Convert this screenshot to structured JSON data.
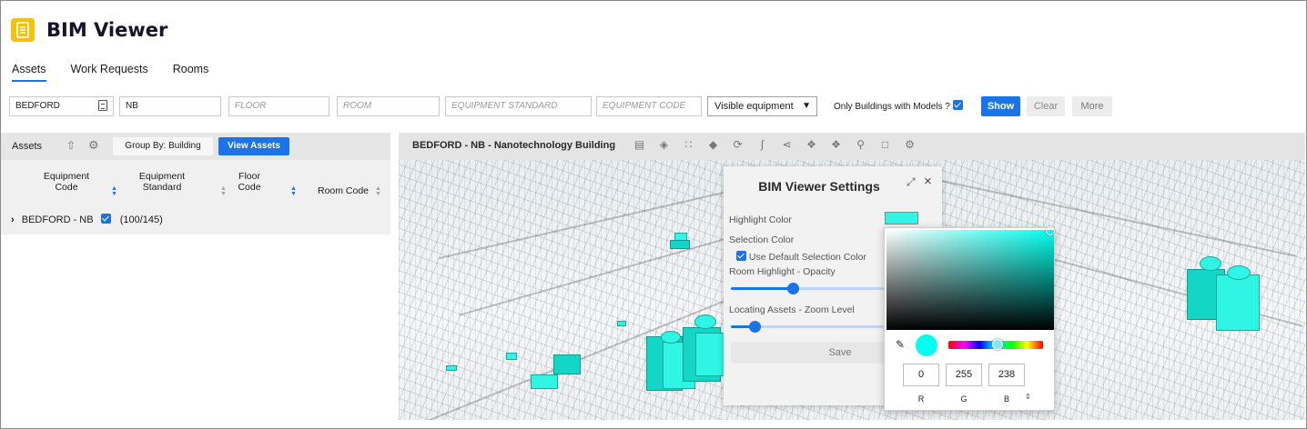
{
  "app": {
    "title": "BIM Viewer",
    "logo_icon": "building-document-icon",
    "logo_color": "#f4c20d"
  },
  "tabs": [
    {
      "label": "Assets",
      "active": true
    },
    {
      "label": "Work Requests",
      "active": false
    },
    {
      "label": "Rooms",
      "active": false
    }
  ],
  "filters": {
    "site": "BEDFORD",
    "building": "NB",
    "floor_placeholder": "FLOOR",
    "room_placeholder": "ROOM",
    "equipment_standard_placeholder": "EQUIPMENT STANDARD",
    "equipment_code_placeholder": "EQUIPMENT CODE",
    "visibility_select": "Visible equipment",
    "only_models_label": "Only Buildings with Models ?",
    "only_models_checked": true,
    "show_label": "Show",
    "clear_label": "Clear",
    "more_label": "More"
  },
  "assets_panel": {
    "title": "Assets",
    "group_by_label": "Group By: Building",
    "view_assets_label": "View Assets",
    "columns": [
      {
        "line1": "Equipment",
        "line2": "Code"
      },
      {
        "line1": "Equipment",
        "line2": "Standard"
      },
      {
        "line1": "Floor",
        "line2": "Code"
      },
      {
        "line1": "Room Code",
        "line2": ""
      }
    ],
    "group_row": {
      "label": "BEDFORD - NB",
      "checked": true,
      "count": "(100/145)"
    }
  },
  "viewer": {
    "title": "BEDFORD - NB - Nanotechnology Building",
    "toolbar_icons": [
      "floors-icon",
      "layers-icon",
      "grid-icon",
      "tag-icon",
      "rotate-icon",
      "section-icon",
      "share-icon",
      "ghost-icon",
      "orbit-icon",
      "search-icon",
      "document-icon",
      "settings-icon"
    ]
  },
  "settings": {
    "title": "BIM Viewer Settings",
    "highlight_color_label": "Highlight Color",
    "highlight_color": "#2ef5e4",
    "selection_color_label": "Selection Color",
    "use_default_selection_label": "Use Default Selection Color",
    "use_default_selection_checked": true,
    "room_opacity_label": "Room Highlight - Opacity",
    "zoom_level_label": "Locating Assets - Zoom Level",
    "save_label": "Save"
  },
  "color_picker": {
    "r": "0",
    "g": "255",
    "b": "238",
    "r_label": "R",
    "g_label": "G",
    "b_label": "B",
    "swatch_color": "#00ffee"
  }
}
